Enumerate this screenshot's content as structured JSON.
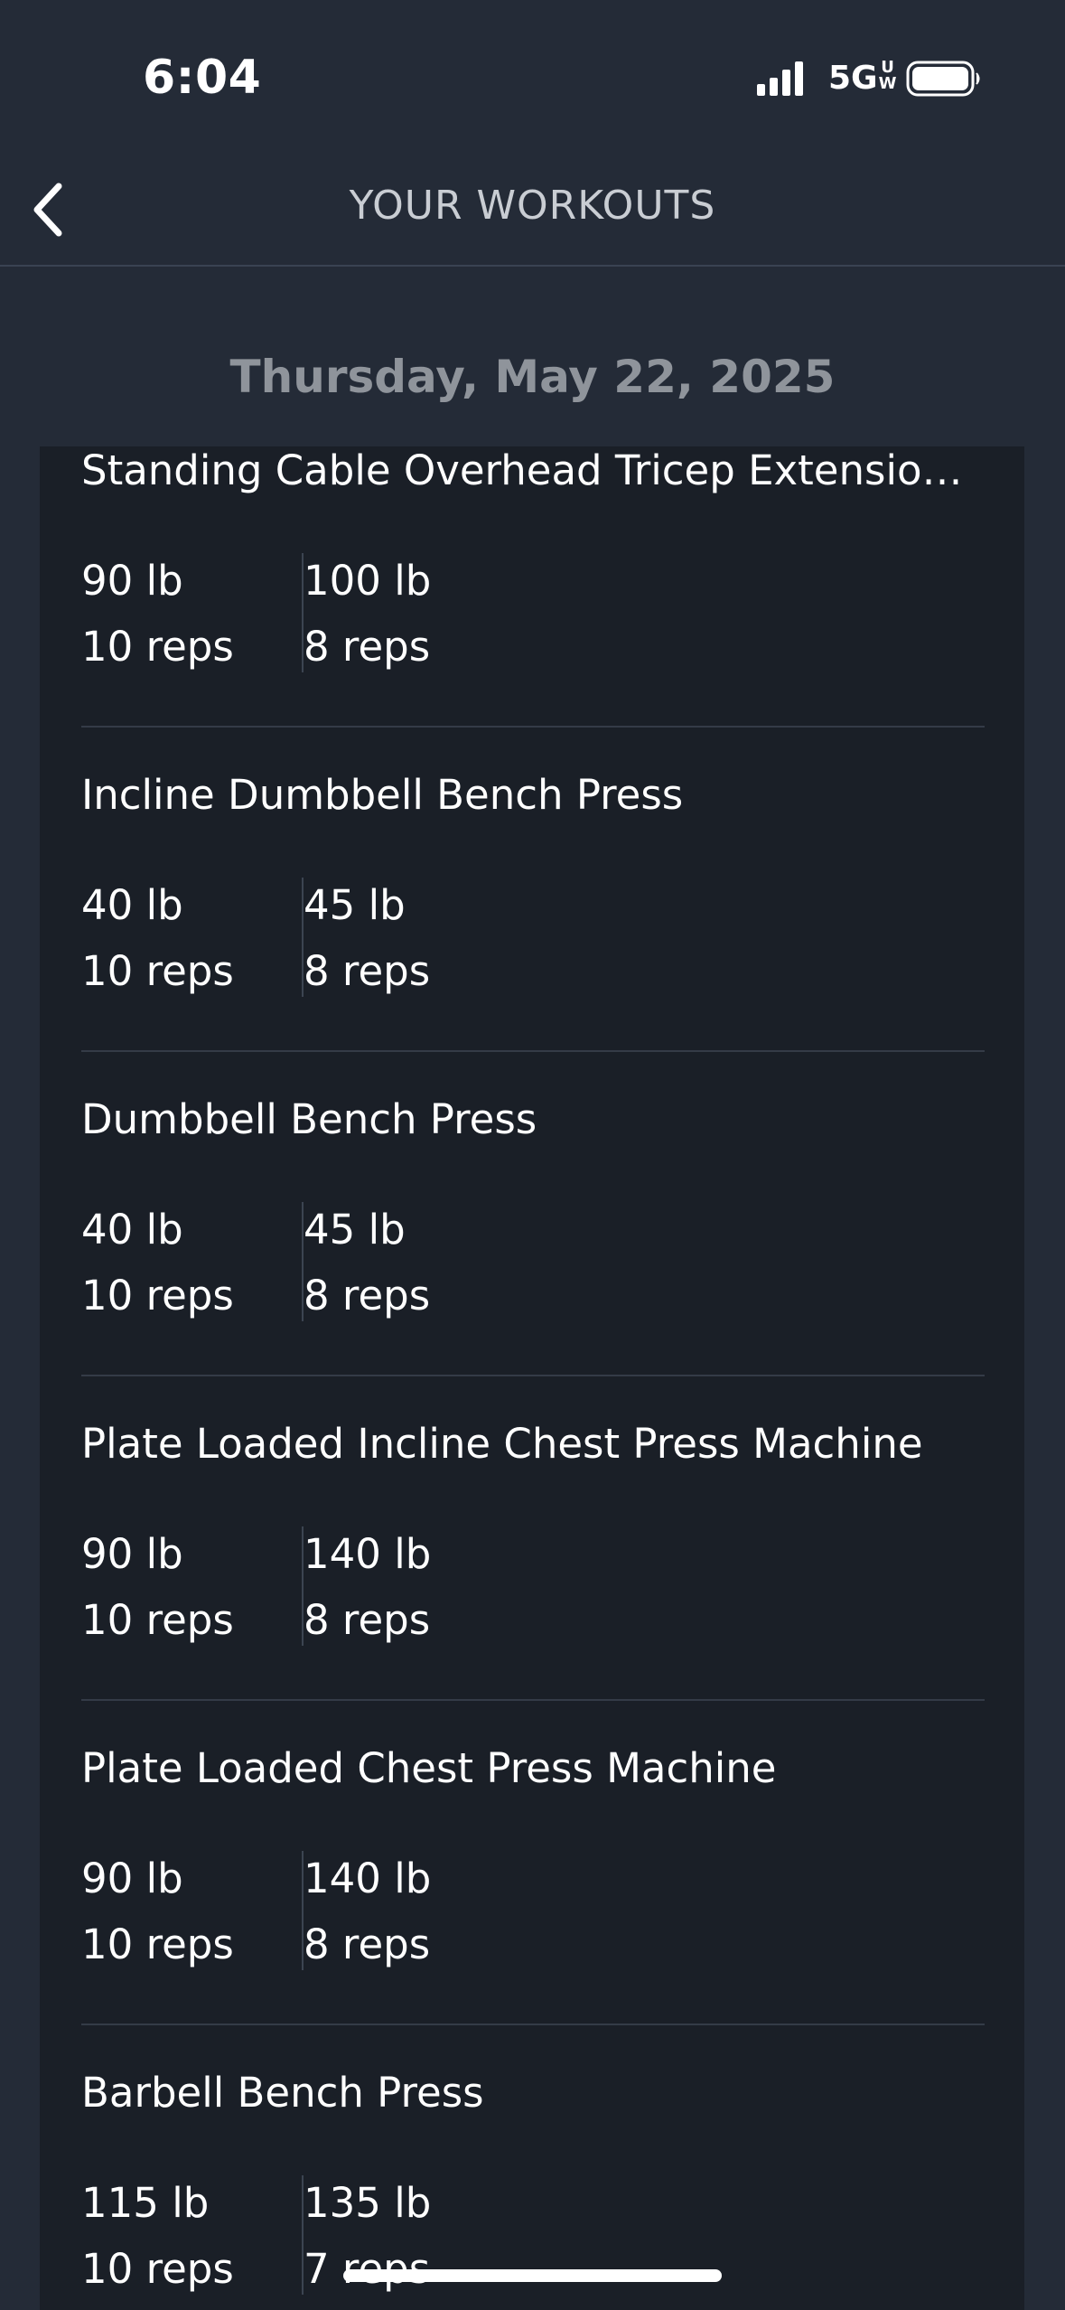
{
  "status_bar": {
    "time": "6:04",
    "network": "5G",
    "network_sup": "UW"
  },
  "nav": {
    "title": "YOUR WORKOUTS"
  },
  "date": "Thursday, May 22, 2025",
  "exercises": [
    {
      "name": "Standing Cable Overhead Tricep Extensio…",
      "sets": [
        {
          "weight": "90 lb",
          "reps": "10 reps"
        },
        {
          "weight": "100 lb",
          "reps": "8 reps"
        }
      ]
    },
    {
      "name": "Incline Dumbbell Bench Press",
      "sets": [
        {
          "weight": "40 lb",
          "reps": "10 reps"
        },
        {
          "weight": "45 lb",
          "reps": "8 reps"
        }
      ]
    },
    {
      "name": "Dumbbell Bench Press",
      "sets": [
        {
          "weight": "40 lb",
          "reps": "10 reps"
        },
        {
          "weight": "45 lb",
          "reps": "8 reps"
        }
      ]
    },
    {
      "name": "Plate Loaded Incline Chest Press Machine",
      "sets": [
        {
          "weight": "90 lb",
          "reps": "10 reps"
        },
        {
          "weight": "140 lb",
          "reps": "8 reps"
        }
      ]
    },
    {
      "name": "Plate Loaded Chest Press Machine",
      "sets": [
        {
          "weight": "90 lb",
          "reps": "10 reps"
        },
        {
          "weight": "140 lb",
          "reps": "8 reps"
        }
      ]
    },
    {
      "name": "Barbell Bench Press",
      "sets": [
        {
          "weight": "115 lb",
          "reps": "10 reps"
        },
        {
          "weight": "135 lb",
          "reps": "7 reps"
        }
      ]
    }
  ],
  "colors": {
    "background": "#242b37",
    "card": "#1a1f27",
    "date_text": "#8f949b",
    "nav_title": "#c9cdd3"
  }
}
